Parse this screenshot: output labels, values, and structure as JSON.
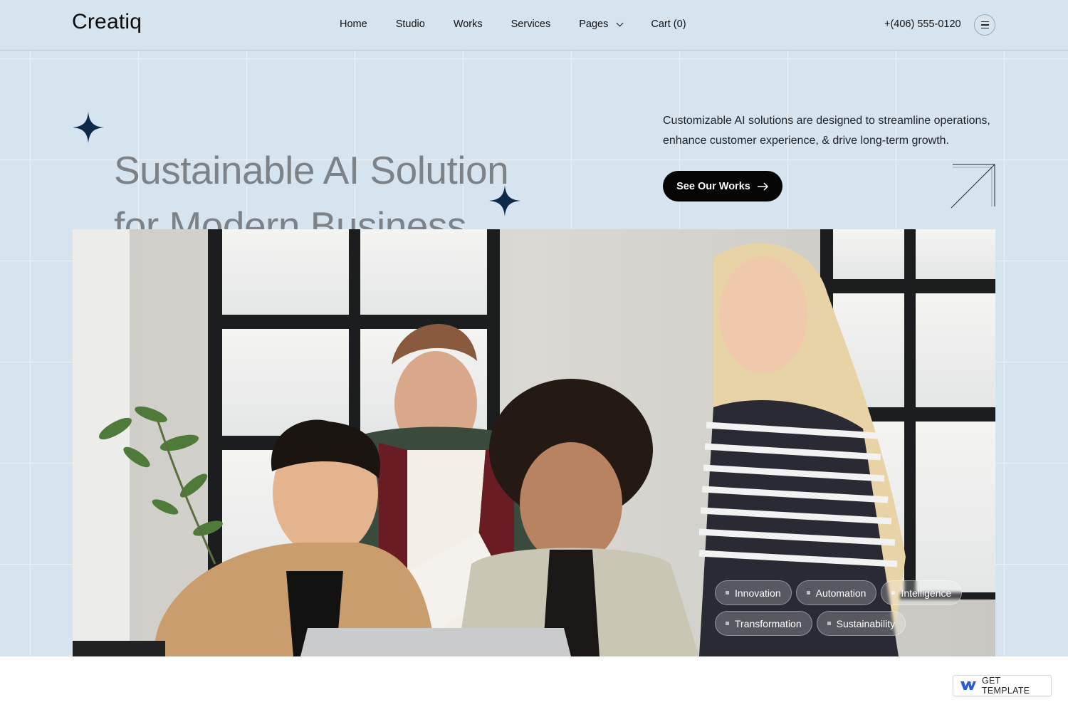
{
  "header": {
    "logo": "Creatiq",
    "nav": [
      {
        "label": "Home"
      },
      {
        "label": "Studio"
      },
      {
        "label": "Works"
      },
      {
        "label": "Services"
      },
      {
        "label": "Pages",
        "has_dropdown": true
      },
      {
        "label": "Cart (0)"
      }
    ],
    "phone": "+(406) 555-0120",
    "menu_icon": "hamburger-menu-icon"
  },
  "hero": {
    "headline_line1": "Sustainable AI Solution",
    "headline_line2": "for Modern Business",
    "description": "Customizable AI solutions are designed to streamline operations, enhance customer experience, & drive long-term growth.",
    "cta_label": "See Our Works",
    "cta_icon": "arrow-right-icon",
    "decor_icons": [
      "sparkle-icon",
      "sparkle-icon",
      "arrow-up-right-icon"
    ]
  },
  "photo": {
    "tags_row1": [
      "Innovation",
      "Automation",
      "Intelligence"
    ],
    "tags_row2": [
      "Transformation",
      "Sustainability"
    ]
  },
  "badge": {
    "label": "GET TEMPLATE",
    "icon": "webflow-logo-icon"
  },
  "colors": {
    "hero_background": "#d6e4ef",
    "sparkle": "#0e2a4a",
    "cta_background": "#050505",
    "headline": "#7b8288"
  }
}
